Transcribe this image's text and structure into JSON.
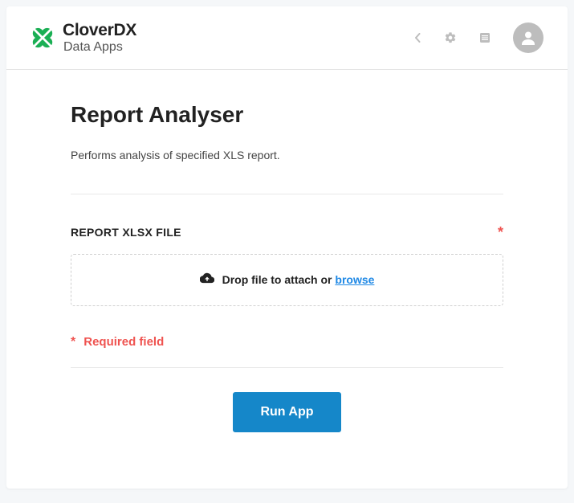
{
  "header": {
    "brand_main": "CloverDX",
    "brand_sub": "Data Apps"
  },
  "page": {
    "title": "Report Analyser",
    "description": "Performs analysis of specified XLS report."
  },
  "field": {
    "label": "REPORT XLSX FILE",
    "required_mark": "*"
  },
  "dropzone": {
    "text": "Drop file to attach or ",
    "browse": "browse"
  },
  "required_note": {
    "mark": "*",
    "text": "Required field"
  },
  "actions": {
    "run_label": "Run App"
  },
  "colors": {
    "accent": "#1587c9",
    "brand": "#1aaf54",
    "danger": "#ef5350"
  }
}
